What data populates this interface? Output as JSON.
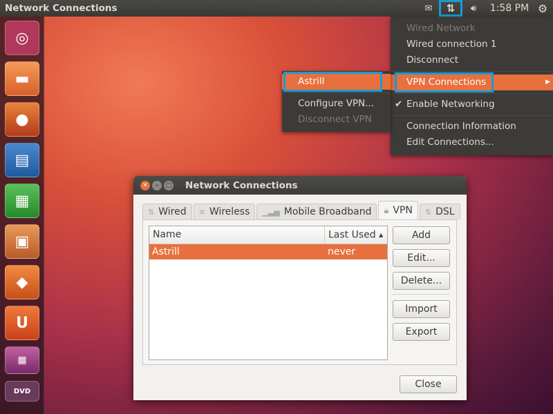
{
  "topbar": {
    "title": "Network Connections",
    "time": "1:58 PM",
    "icons": [
      "mail-icon",
      "network-icon",
      "volume-icon",
      "gear-icon"
    ]
  },
  "launcher": {
    "items": [
      "ubuntu-home",
      "files",
      "firefox",
      "libreoffice-writer",
      "libreoffice-calc",
      "libreoffice-impress",
      "software-center",
      "ubuntu-one",
      "workspace-switcher",
      "dvd"
    ]
  },
  "network_menu": {
    "items": [
      {
        "label": "Wired Network",
        "disabled": true
      },
      {
        "label": "Wired connection 1"
      },
      {
        "label": "Disconnect"
      },
      {
        "label": "VPN Connections",
        "active": true,
        "submenu": true
      },
      {
        "label": "Enable Networking",
        "checked": true
      },
      {
        "label": "Connection Information"
      },
      {
        "label": "Edit Connections..."
      }
    ]
  },
  "vpn_submenu": {
    "items": [
      {
        "label": "Astrill",
        "active": true
      },
      {
        "label": "Configure VPN..."
      },
      {
        "label": "Disconnect VPN",
        "disabled": true
      }
    ]
  },
  "dialog": {
    "title": "Network Connections",
    "tabs": [
      {
        "label": "Wired",
        "icon": "wired-icon"
      },
      {
        "label": "Wireless",
        "icon": "wireless-icon"
      },
      {
        "label": "Mobile Broadband",
        "icon": "signal-icon"
      },
      {
        "label": "VPN",
        "icon": "lock-icon",
        "selected": true
      },
      {
        "label": "DSL",
        "icon": "dsl-icon"
      }
    ],
    "columns": [
      "Name",
      "Last Used"
    ],
    "sort_indicator": "▲",
    "rows": [
      {
        "name": "Astrill",
        "last_used": "never",
        "selected": true
      }
    ],
    "buttons": {
      "add": "Add",
      "edit": "Edit...",
      "delete": "Delete...",
      "import": "Import",
      "export": "Export",
      "close": "Close"
    }
  },
  "colors": {
    "accent": "#e8703e",
    "highlight": "#1a9ad6",
    "menu_bg": "#3c3b37"
  }
}
